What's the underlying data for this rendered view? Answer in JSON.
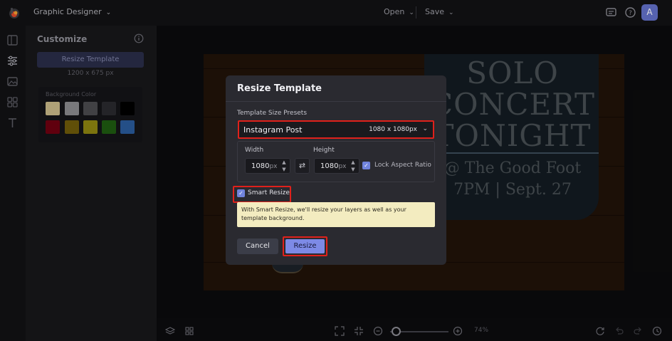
{
  "app": {
    "name": "Graphic Designer"
  },
  "topbar": {
    "open_label": "Open",
    "save_label": "Save",
    "avatar_initial": "A"
  },
  "sidepanel": {
    "title": "Customize",
    "resize_template_button": "Resize Template",
    "dimensions": "1200 x 675 px",
    "background_color_label": "Background Color",
    "swatches": [
      "#c8b888",
      "#8a8a8e",
      "#4a4a4e",
      "#2a2a2e",
      "#000000",
      "#6e0010",
      "#6e5a0a",
      "#8e8410",
      "#1e5a10",
      "#2a5a9a"
    ]
  },
  "poster": {
    "line1": "SOLO",
    "line2": "CONCERT",
    "line3": "TONIGHT",
    "line4": "@ The Good Foot",
    "line5": "7PM | Sept. 27"
  },
  "modal": {
    "title": "Resize Template",
    "preset_label": "Template Size Presets",
    "preset_name": "Instagram Post",
    "preset_size": "1080 x 1080px",
    "width_label": "Width",
    "height_label": "Height",
    "width_value": "1080",
    "height_value": "1080",
    "unit": "px",
    "lock_label": "Lock Aspect Ratio",
    "lock_checked": true,
    "smart_resize_label": "Smart Resize",
    "smart_resize_checked": true,
    "tip": "With Smart Resize, we'll resize your layers as well as your template background.",
    "cancel_label": "Cancel",
    "resize_label": "Resize"
  },
  "bottombar": {
    "zoom_value": "74%"
  },
  "colors": {
    "accent": "#7d8ae6",
    "highlight": "#e0211b",
    "tip_bg": "#f3ecc0"
  }
}
